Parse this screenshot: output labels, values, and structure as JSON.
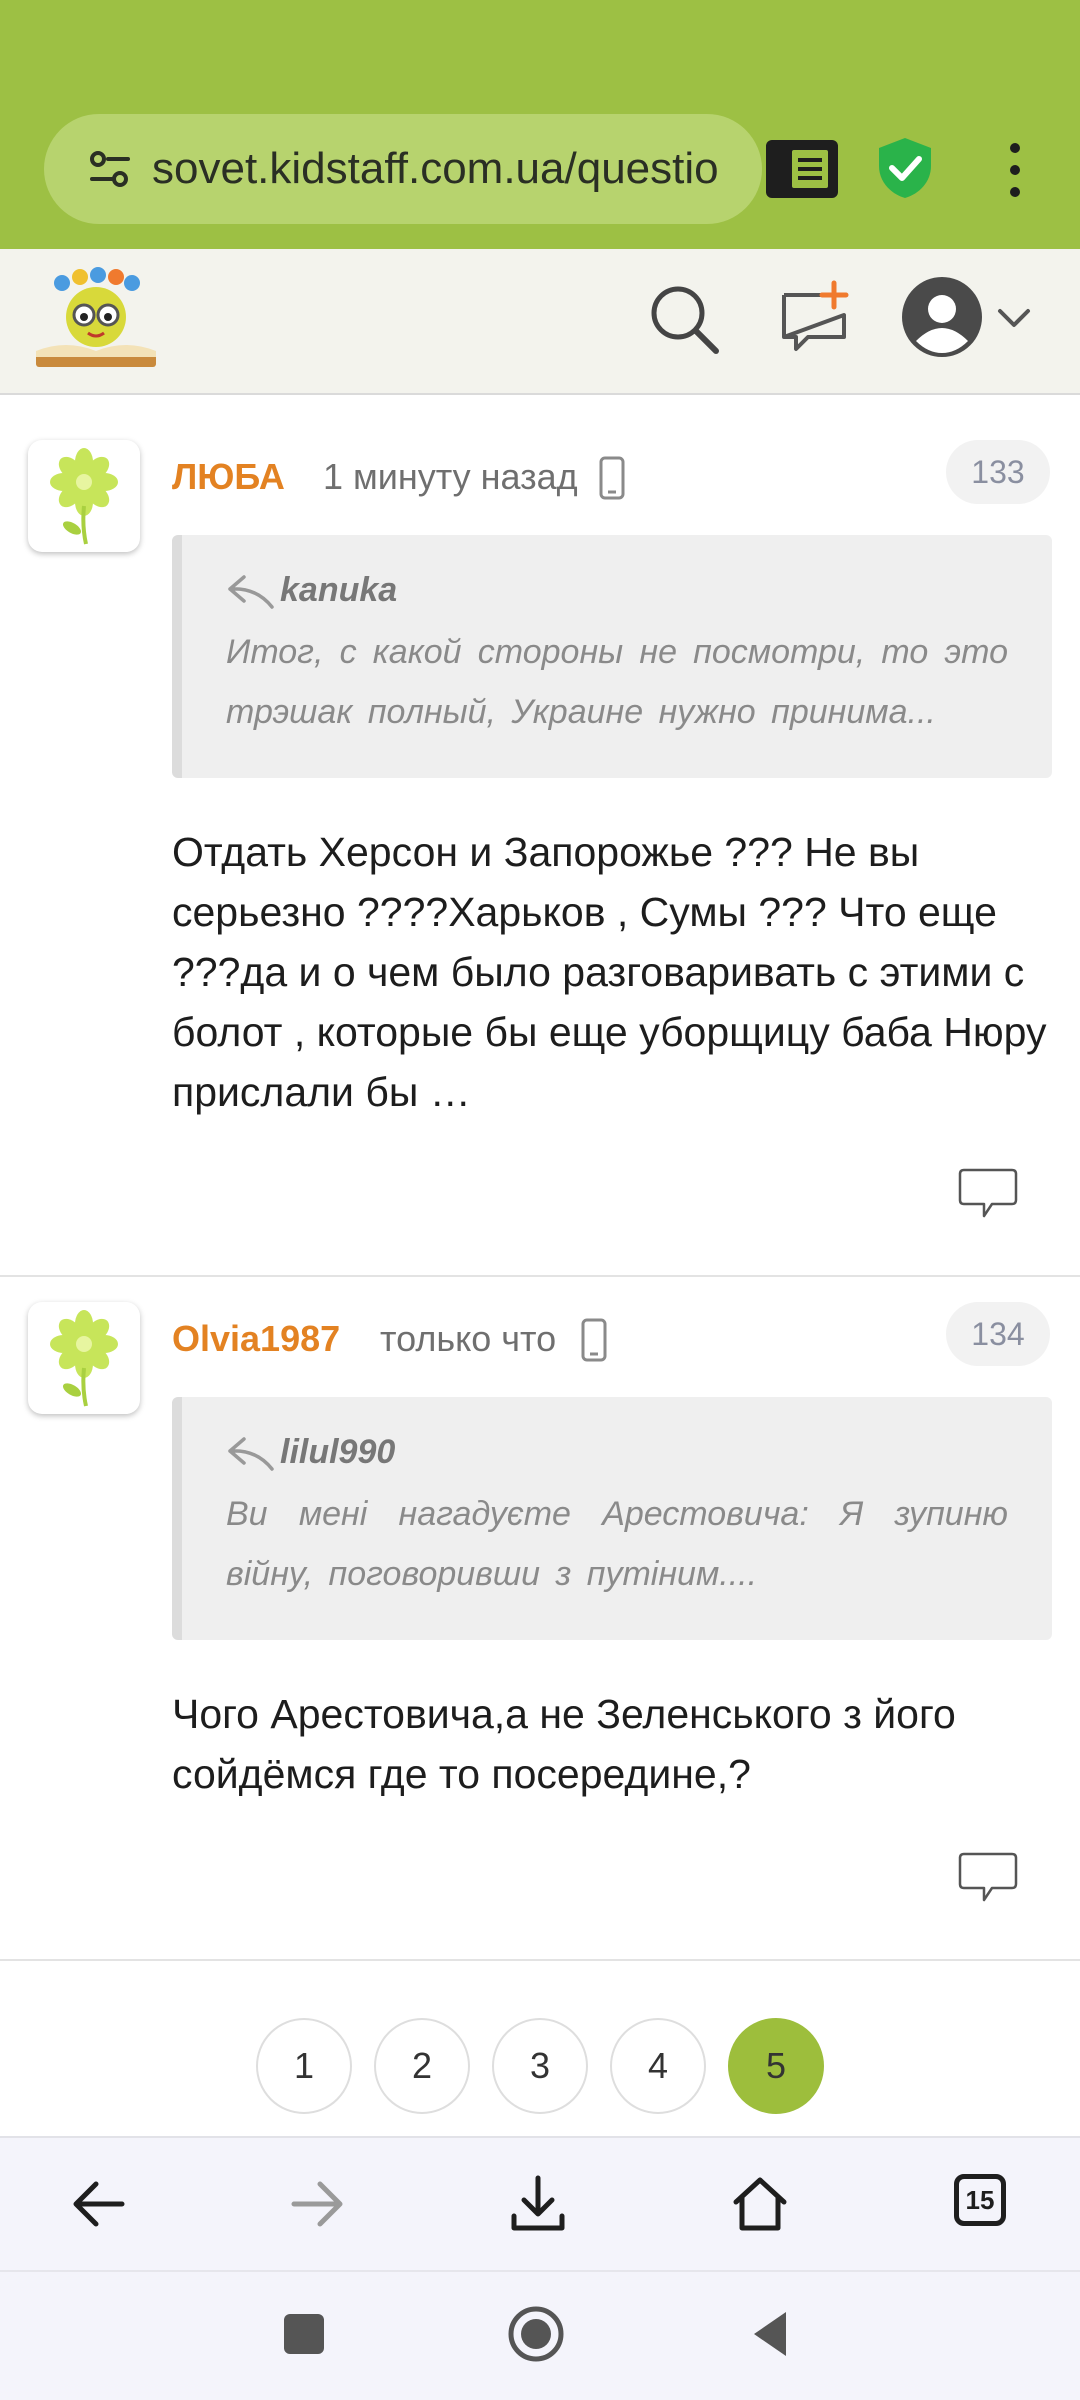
{
  "browser": {
    "url": "sovet.kidstaff.com.ua/questio",
    "tabs_count": "15"
  },
  "comments": [
    {
      "author": "ЛЮБА",
      "time": "1 минуту назад",
      "number": "133",
      "quote_author": "kanuka",
      "quote_text": "Итог, с какой стороны не посмотри, то это трэшак полный, Украине нужно принима...",
      "body": "Отдать Херсон и Запорожье ??? Не вы серьезно ????Харьков , Сумы ??? Что еще ???да и о чем было разговаривать с этими с болот , которые бы еще уборщицу баба Нюру прислали бы …"
    },
    {
      "author": "Olvia1987",
      "time": "только что",
      "number": "134",
      "quote_author": "lilul990",
      "quote_text": "Ви мені нагадуєте Арестовича: Я зупиню війну, поговоривши з путіним....",
      "body": "Чого Арестовича,а не Зеленського з його сойдёмся где то посередине,?"
    }
  ],
  "pagination": {
    "pages": [
      "1",
      "2",
      "3",
      "4",
      "5"
    ],
    "current": "5"
  },
  "colors": {
    "browser_bar": "#9dc044",
    "author": "#e38222",
    "active_page": "#9dbe3c"
  }
}
